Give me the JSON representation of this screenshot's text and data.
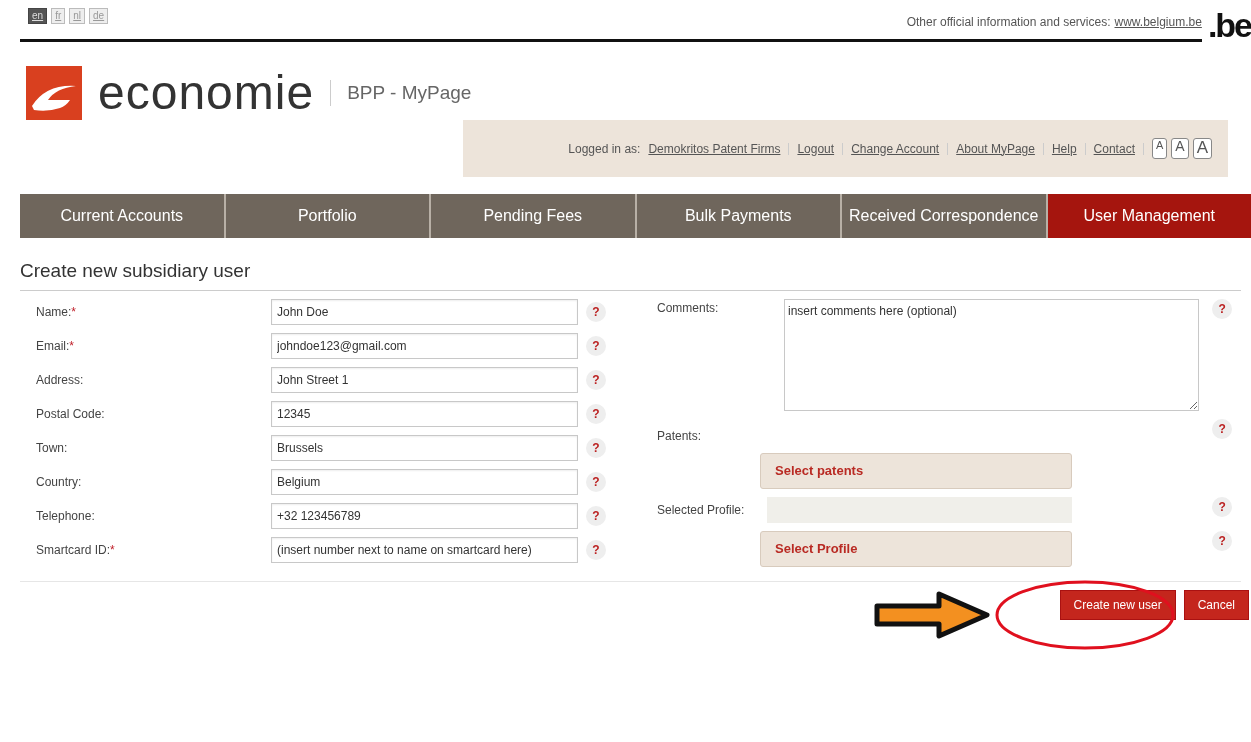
{
  "languages": [
    {
      "label": "en",
      "selected": true
    },
    {
      "label": "fr",
      "selected": false
    },
    {
      "label": "nl",
      "selected": false
    },
    {
      "label": "de",
      "selected": false
    }
  ],
  "official_info": {
    "text": "Other official information and services:",
    "link": "www.belgium.be"
  },
  "be_logo": ".be",
  "brand": {
    "name": "economie",
    "site": "BPP - MyPage"
  },
  "user_bar": {
    "logged_in_label": "Logged in as:",
    "user": "Demokritos Patent Firms",
    "links": [
      "Logout",
      "Change Account",
      "About MyPage",
      "Help",
      "Contact"
    ],
    "font_sizes": [
      "A",
      "A",
      "A"
    ]
  },
  "tabs": [
    {
      "label": "Current Accounts",
      "selected": false
    },
    {
      "label": "Portfolio",
      "selected": false
    },
    {
      "label": "Pending Fees",
      "selected": false
    },
    {
      "label": "Bulk Payments",
      "selected": false
    },
    {
      "label": "Received Correspondence",
      "selected": false
    },
    {
      "label": "User Management",
      "selected": true
    }
  ],
  "heading": "Create new subsidiary user",
  "left_fields": [
    {
      "label": "Name:",
      "required_mark": "*",
      "value": "John Doe",
      "help": "?"
    },
    {
      "label": "Email:",
      "required_mark": "*",
      "value": "johndoe123@gmail.com",
      "help": "?"
    },
    {
      "label": "Address:",
      "value": "John Street 1",
      "help": "?"
    },
    {
      "label": "Postal Code:",
      "value": "12345",
      "help": "?"
    },
    {
      "label": "Town:",
      "value": "Brussels",
      "help": "?"
    },
    {
      "label": "Country:",
      "value": "Belgium",
      "help": "?"
    },
    {
      "label": "Telephone:",
      "value": "+32 123456789",
      "help": "?"
    },
    {
      "label": "Smartcard ID:",
      "required_mark": "*",
      "value": "(insert number next to name on smartcard here)",
      "help": "?"
    }
  ],
  "right_fields": [
    {
      "kind": "textarea",
      "label": "Comments:",
      "value": "insert comments here (optional)",
      "help": "?"
    },
    {
      "kind": "label",
      "label": "Patents:",
      "help": "?"
    },
    {
      "kind": "button",
      "text": "Select patents"
    },
    {
      "kind": "readonly",
      "label": "Selected Profile:",
      "help": "?"
    },
    {
      "kind": "button",
      "text": "Select Profile",
      "help": "?"
    }
  ],
  "actions": [
    "Create new user",
    "Cancel"
  ],
  "annotations": [
    {
      "kind": "arrow",
      "color": "#f39020"
    },
    {
      "kind": "ellipse",
      "color": "#e0101e"
    }
  ]
}
